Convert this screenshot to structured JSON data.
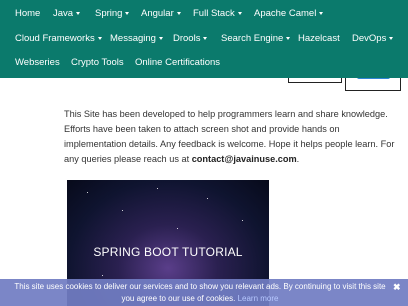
{
  "nav": {
    "items": [
      {
        "label": "Home",
        "dropdown": false
      },
      {
        "label": "Java",
        "dropdown": true
      },
      {
        "label": "Spring",
        "dropdown": true
      },
      {
        "label": "Angular",
        "dropdown": true
      },
      {
        "label": "Full Stack",
        "dropdown": true
      },
      {
        "label": "Apache Camel",
        "dropdown": true
      },
      {
        "label": "Cloud Frameworks",
        "dropdown": true
      },
      {
        "label": "Messaging",
        "dropdown": true
      },
      {
        "label": "Drools",
        "dropdown": true
      },
      {
        "label": "Search Engine",
        "dropdown": true
      },
      {
        "label": "Hazelcast",
        "dropdown": false
      },
      {
        "label": "DevOps",
        "dropdown": true
      },
      {
        "label": "Webseries",
        "dropdown": false
      },
      {
        "label": "Crypto Tools",
        "dropdown": false
      },
      {
        "label": "Online Certifications",
        "dropdown": false
      }
    ]
  },
  "main": {
    "intro_text": "This Site has been developed to help programmers learn and share knowledge. Efforts have been taken to attach screen shot and provide hands on implementation details. Any feedback is welcome. Hope it helps people learn. For any queries please reach us at ",
    "contact_email": "contact@javainuse.com",
    "contact_suffix": "."
  },
  "banner": {
    "title": "SPRING BOOT TUTORIAL"
  },
  "cookie_bar": {
    "text": "This site uses cookies to deliver our services and to show you relevant ads. By continuing to visit this site you agree to our use of cookies.",
    "link": "Learn more",
    "close": "✖"
  },
  "colors": {
    "nav_bg": "#0b7a6c",
    "cookie_bg": "#717dc3"
  }
}
